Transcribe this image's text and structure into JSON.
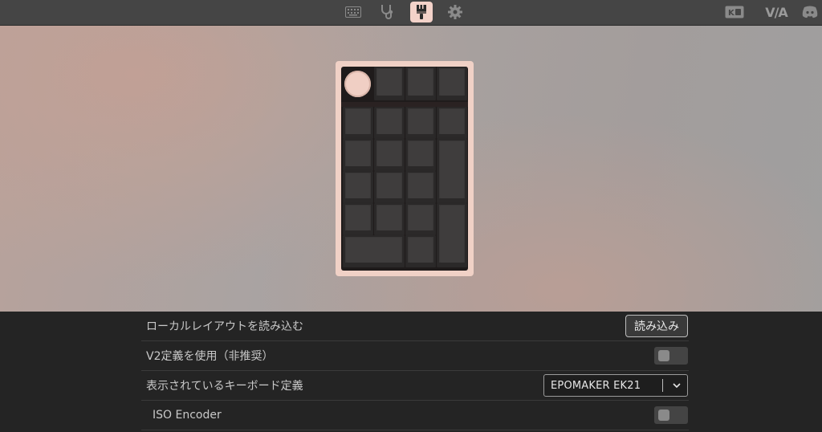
{
  "topbar": {
    "nav_icons": [
      "keyboard-icon",
      "stethoscope-icon",
      "paintbrush-icon",
      "gear-icon"
    ],
    "active": "paintbrush-icon",
    "right_icons": [
      "keycap-tester-icon",
      "via-logo",
      "discord-icon"
    ],
    "via_label": "V/A"
  },
  "colors": {
    "accent": "#f0d1c6",
    "keycap": "#3a3838",
    "panel": "#242424",
    "topbar": "#454545"
  },
  "settings": {
    "rows": [
      {
        "label": "ローカルレイアウトを読み込む",
        "control": "button",
        "button_label": "読み込み"
      },
      {
        "label": "V2定義を使用（非推奨）",
        "control": "toggle",
        "value": false
      },
      {
        "label": "表示されているキーボード定義",
        "control": "select",
        "selected": "EPOMAKER EK21"
      },
      {
        "label": "ISO Encoder",
        "control": "toggle",
        "value": false
      }
    ]
  }
}
